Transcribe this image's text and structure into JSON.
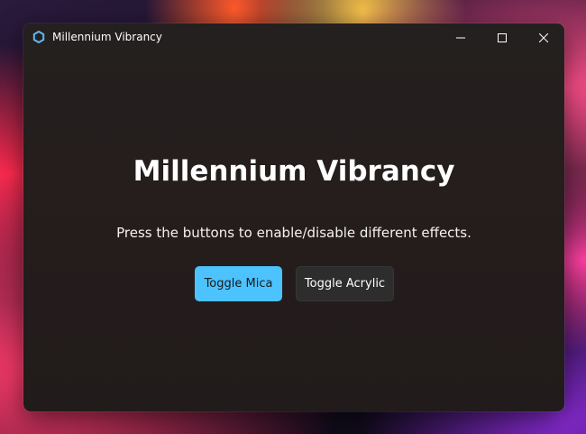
{
  "window": {
    "title": "Millennium Vibrancy",
    "app_icon": "hexagon-icon",
    "controls": {
      "minimize_icon": "minimize-icon",
      "maximize_icon": "maximize-icon",
      "close_icon": "close-icon"
    }
  },
  "main": {
    "heading": "Millennium Vibrancy",
    "description": "Press the buttons to enable/disable different effects.",
    "buttons": [
      {
        "label": "Toggle Mica",
        "style": "accent"
      },
      {
        "label": "Toggle Acrylic",
        "style": "default"
      }
    ]
  },
  "colors": {
    "accent": "#4cc2ff",
    "window_background": "#251d1c",
    "secondary_button": "#2d2d2d",
    "text": "#ffffff"
  }
}
